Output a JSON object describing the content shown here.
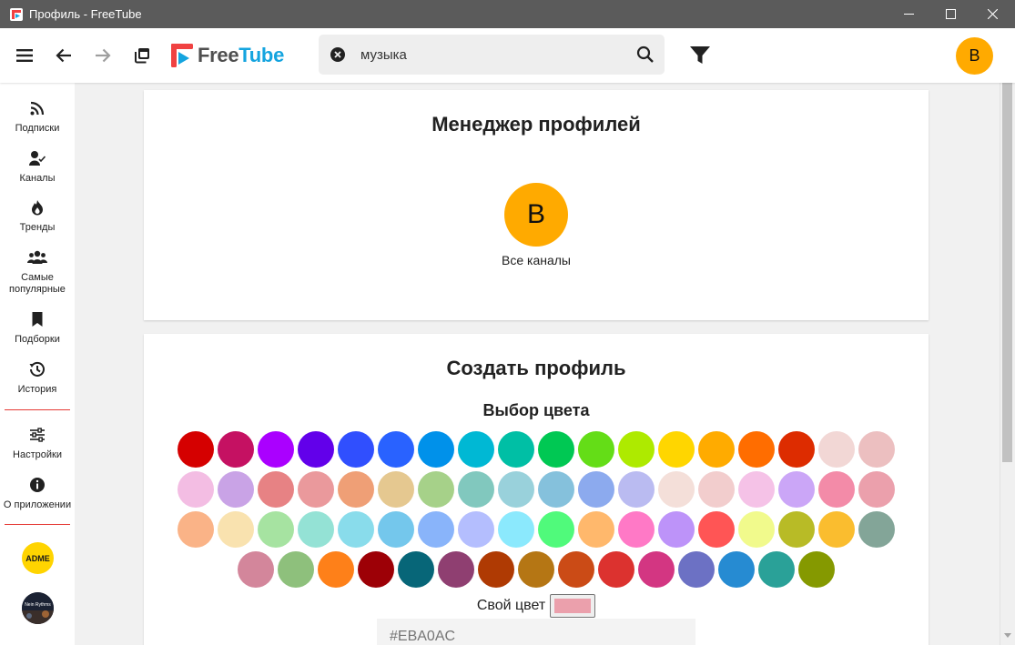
{
  "window": {
    "title": "Профиль - FreeTube"
  },
  "topnav": {
    "logo_free": "Free",
    "logo_tube": "Tube",
    "search_value": "музыка",
    "avatar_letter": "B"
  },
  "sidebar": {
    "items": [
      {
        "label": "Подписки",
        "icon": "rss-icon"
      },
      {
        "label": "Каналы",
        "icon": "user-check-icon"
      },
      {
        "label": "Тренды",
        "icon": "fire-icon"
      },
      {
        "label": "Самые популярные",
        "icon": "users-icon"
      },
      {
        "label": "Подборки",
        "icon": "bookmark-icon"
      },
      {
        "label": "История",
        "icon": "history-icon"
      },
      {
        "label": "Настройки",
        "icon": "sliders-icon"
      },
      {
        "label": "О приложении",
        "icon": "info-icon"
      }
    ],
    "channels": [
      {
        "text": "ADME",
        "bg": "#ffd400",
        "fg": "#1a1a1a"
      },
      {
        "text": "Nein Rythms",
        "bg": "#1b2233",
        "fg": "#ffffff"
      }
    ]
  },
  "profile_manager": {
    "title": "Менеджер профилей",
    "profile_letter": "B",
    "profile_color": "#FFAA00",
    "profile_name": "Все каналы"
  },
  "create_profile": {
    "title": "Создать профиль",
    "color_picker_label": "Выбор цвета",
    "custom_color_label": "Свой цвет",
    "custom_color_value": "#EBA0AC",
    "hex_placeholder": "#EBA0AC",
    "color_rows": [
      [
        "#d50000",
        "#c51162",
        "#aa00ff",
        "#6200ea",
        "#304ffe",
        "#2962ff",
        "#0091ea",
        "#00b8d4",
        "#00bfa5",
        "#00c853",
        "#64dd17",
        "#aeea00",
        "#ffd600",
        "#ffab00",
        "#ff6d00",
        "#dd2c00",
        "#f2d7d5",
        "#ecbfc0"
      ],
      [
        "#f3bde3",
        "#c9a3e6",
        "#e78284",
        "#ea999c",
        "#ef9f76",
        "#e5c890",
        "#a6d189",
        "#81c8be",
        "#99d1db",
        "#85c1dc",
        "#8caaee",
        "#babbf1",
        "#f4dfd9",
        "#f2cdcd",
        "#f5c2e7",
        "#cba6f7",
        "#f38ba8",
        "#eba0ac"
      ],
      [
        "#fab387",
        "#f9e2af",
        "#a6e3a1",
        "#94e2d5",
        "#89dceb",
        "#74c7ec",
        "#89b4fa",
        "#b4befe",
        "#8be9fd",
        "#50fa7b",
        "#ffb86c",
        "#ff79c6",
        "#bd93f9",
        "#ff5555",
        "#f1fa8c",
        "#b8bb26",
        "#fabd2f",
        "#83a598"
      ],
      [
        "#d3869b",
        "#8ec07c",
        "#fe8019",
        "#9d0006",
        "#076678",
        "#8f3f71",
        "#af3a03",
        "#b57614",
        "#cb4b16",
        "#dc322f",
        "#d33682",
        "#6c71c4",
        "#268bd2",
        "#2aa198",
        "#859900"
      ]
    ]
  }
}
